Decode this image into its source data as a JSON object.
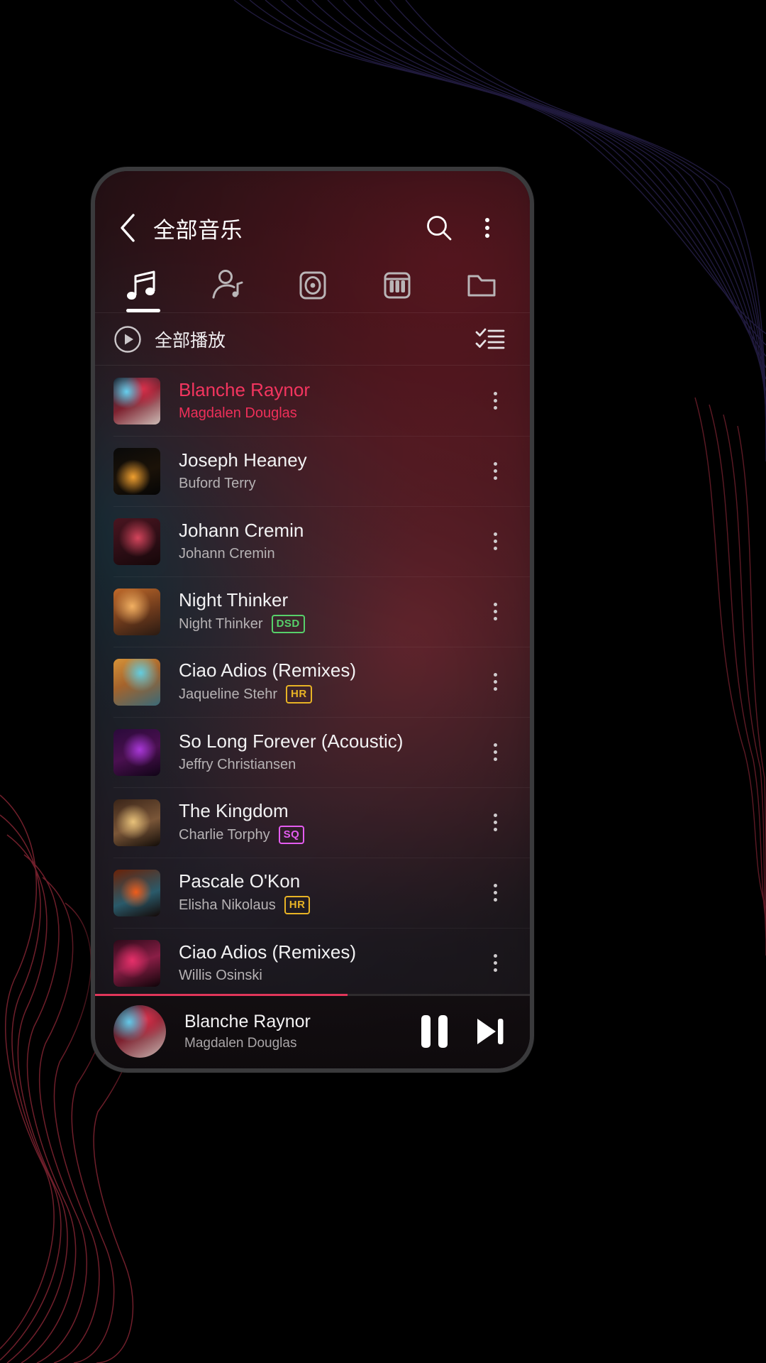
{
  "app": {
    "header": {
      "title": "全部音乐",
      "back_icon": "chevron-left-icon",
      "search_icon": "search-icon",
      "overflow_icon": "more-vertical-icon"
    },
    "tabs": [
      {
        "name": "songs",
        "icon": "music-note-icon",
        "active": true
      },
      {
        "name": "artists",
        "icon": "artist-icon",
        "active": false
      },
      {
        "name": "albums",
        "icon": "album-disc-icon",
        "active": false
      },
      {
        "name": "genres",
        "icon": "piano-keys-icon",
        "active": false
      },
      {
        "name": "folders",
        "icon": "folder-icon",
        "active": false
      }
    ],
    "playall": {
      "label": "全部播放",
      "play_icon": "play-circle-icon",
      "multiselect_icon": "checklist-icon"
    },
    "songs": [
      {
        "title": "Blanche Raynor",
        "artist": "Magdalen Douglas",
        "badge": "",
        "playing": true
      },
      {
        "title": "Joseph Heaney",
        "artist": "Buford Terry",
        "badge": "",
        "playing": false
      },
      {
        "title": "Johann Cremin",
        "artist": "Johann Cremin",
        "badge": "",
        "playing": false
      },
      {
        "title": "Night Thinker",
        "artist": "Night Thinker",
        "badge": "DSD",
        "playing": false
      },
      {
        "title": "Ciao Adios (Remixes)",
        "artist": "Jaqueline Stehr",
        "badge": "HR",
        "playing": false
      },
      {
        "title": "So Long Forever (Acoustic)",
        "artist": "Jeffry Christiansen",
        "badge": "",
        "playing": false
      },
      {
        "title": "The Kingdom",
        "artist": "Charlie Torphy",
        "badge": "SQ",
        "playing": false
      },
      {
        "title": "Pascale O'Kon",
        "artist": "Elisha Nikolaus",
        "badge": "HR",
        "playing": false
      },
      {
        "title": "Ciao Adios (Remixes)",
        "artist": "Willis Osinski",
        "badge": "",
        "playing": false
      }
    ],
    "miniplayer": {
      "title": "Blanche Raynor",
      "artist": "Magdalen Douglas",
      "pause_icon": "pause-icon",
      "next_icon": "skip-next-icon",
      "progress_percent": 58
    },
    "colors": {
      "accent": "#e0365a",
      "playing_title": "#f3355f",
      "playing_artist": "#ee2f59",
      "badge_dsd": "#57d06a",
      "badge_hr": "#e8b325",
      "badge_sq": "#e45cf0"
    }
  }
}
